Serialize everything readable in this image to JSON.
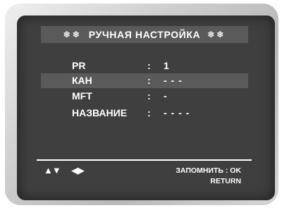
{
  "menu": {
    "title": "РУЧНАЯ НАСТРОЙКА",
    "title_decoration": "❄❄",
    "rows": [
      {
        "label": "PR",
        "separator": ":",
        "value": "1"
      },
      {
        "label": "КАН",
        "separator": ":",
        "value": "- - -",
        "selected": true
      },
      {
        "label": "MFT",
        "separator": ":",
        "value": "-"
      },
      {
        "label": "НАЗВАНИЕ",
        "separator": ":",
        "value": "- - - -"
      }
    ]
  },
  "footer": {
    "icons": [
      "up-down-arrows-icon",
      "left-right-arrows-icon"
    ],
    "up_down": "▲▼",
    "left_right": "◀▶",
    "save_hint": "ЗАПОМНИТЬ : OK",
    "return_hint": "RETURN"
  },
  "colors": {
    "screen_bg": "#3f3f3f",
    "highlight_bg": "#5a5a5a",
    "text": "#ffffff"
  }
}
